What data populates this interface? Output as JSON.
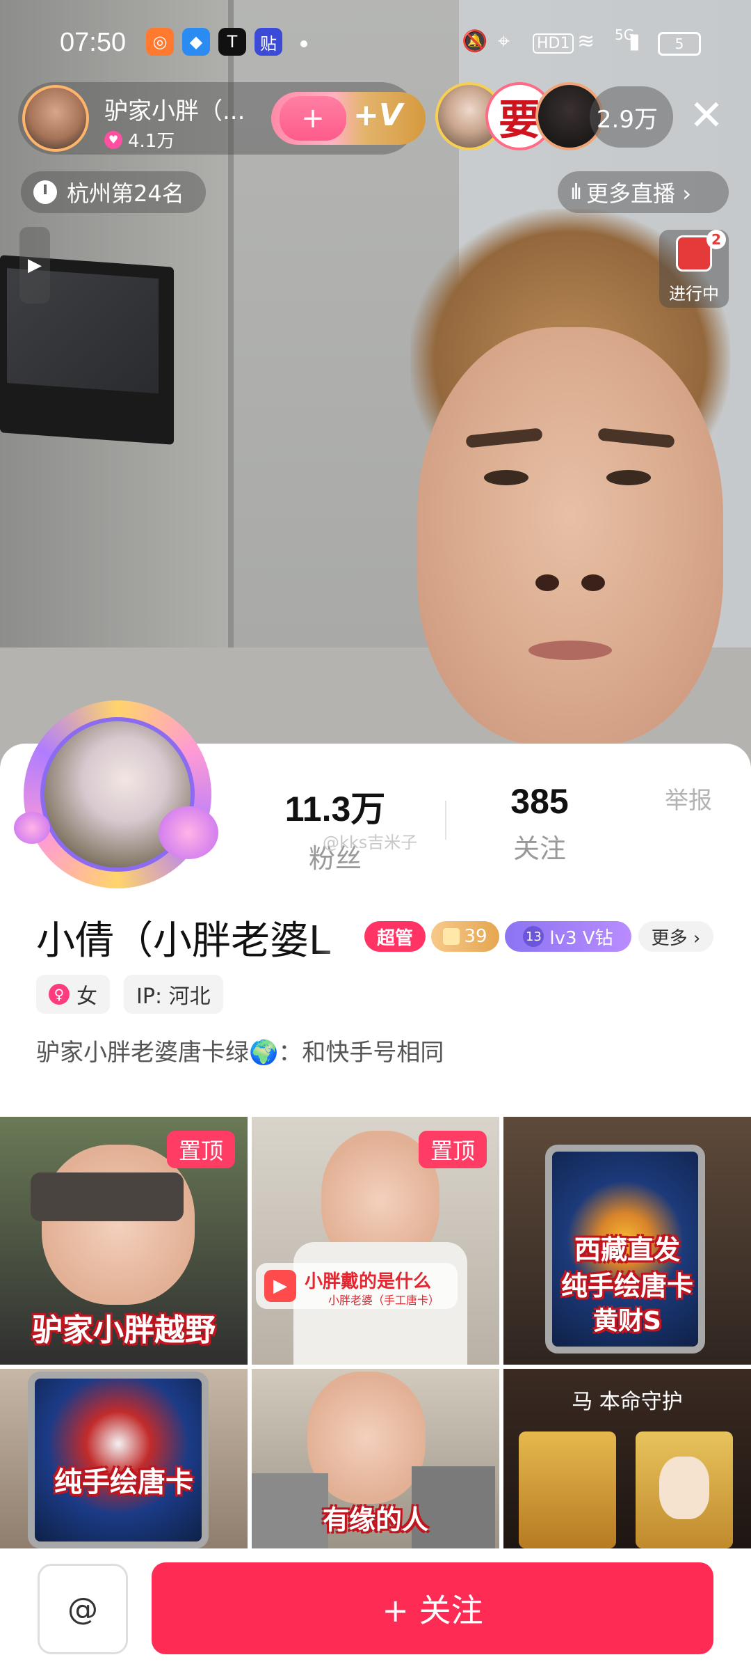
{
  "status_bar": {
    "time": "07:50",
    "net_label": "HD1",
    "signal_label": "5G",
    "battery": "5",
    "app_icon_tiktok": "T",
    "app_icon_post": "贴"
  },
  "live_header": {
    "host_name": "驴家小胖（...",
    "host_likes": "4.1万",
    "follow_heart_glyph": "+",
    "follow_v_label": "+V",
    "viewer_badge_text": "要",
    "viewer_count": "2.9万",
    "close_glyph": "✕",
    "rank_label": "杭州第24名",
    "more_live_label": "更多直播 ›",
    "side_toggle_glyph": "▶",
    "in_progress_badge": "2",
    "in_progress_label": "进行中"
  },
  "profile": {
    "followers_value": "11.3万",
    "followers_label": "粉丝",
    "following_value": "385",
    "following_label": "关注",
    "report_label": "举报",
    "watermark": "@kks吉米子",
    "display_name": "小倩（小胖老婆L",
    "tags": {
      "admin": "超管",
      "gold_count": "39",
      "level_num": "13",
      "level_text": "lv3 V钻",
      "more": "更多 ›"
    },
    "gender_label": "女",
    "ip_label": "IP: 河北",
    "bio": "驴家小胖老婆唐卡绿🌍：和快手号相同"
  },
  "grid": {
    "pin_label": "置顶",
    "tile1_caption": "驴家小胖越野",
    "tile2_caption": "有缘的人",
    "tile2_stamp_title": "小胖戴的是什么",
    "tile2_stamp_sub": "小胖老婆（手工唐卡）",
    "tile3_caption_1": "西藏直发",
    "tile3_caption_2": "纯手绘唐卡",
    "tile3_caption_3": "黄财S",
    "tile4_caption": "纯手绘唐卡",
    "tile6_caption": "有缘的人",
    "tile6_header": "马 本命守护"
  },
  "bottom_bar": {
    "at_label": "@",
    "follow_label": "+ 关注"
  },
  "colors": {
    "accent": "#fe2c55",
    "admin_tag": "#ff3464",
    "level_tag": "#8b74f2"
  },
  "icons": [
    "clock-icon",
    "bars-icon",
    "close-icon",
    "heart-icon",
    "female-icon",
    "globe-icon",
    "play-icon"
  ]
}
